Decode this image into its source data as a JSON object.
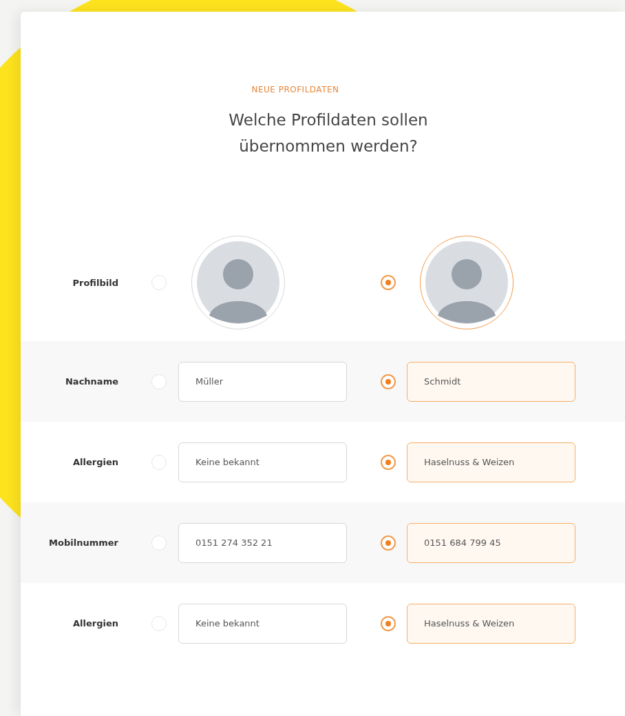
{
  "eyebrow": "NEUE PROFILDATEN",
  "heading": "Welche Profildaten sollen übernommen werden?",
  "rows": [
    {
      "kind": "photo",
      "label": "Profilbild",
      "options": [
        {
          "selected": false
        },
        {
          "selected": true
        }
      ]
    },
    {
      "kind": "text",
      "label": "Nachname",
      "options": [
        {
          "value": "Müller",
          "selected": false
        },
        {
          "value": "Schmidt",
          "selected": true
        }
      ]
    },
    {
      "kind": "text",
      "label": "Allergien",
      "options": [
        {
          "value": "Keine bekannt",
          "selected": false
        },
        {
          "value": "Haselnuss & Weizen",
          "selected": true
        }
      ]
    },
    {
      "kind": "text",
      "label": "Mobilnummer",
      "options": [
        {
          "value": "0151 274 352 21",
          "selected": false
        },
        {
          "value": "0151 684 799 45",
          "selected": true
        }
      ]
    },
    {
      "kind": "text",
      "label": "Allergien",
      "options": [
        {
          "value": "Keine bekannt",
          "selected": false
        },
        {
          "value": "Haselnuss & Weizen",
          "selected": true
        }
      ]
    }
  ]
}
